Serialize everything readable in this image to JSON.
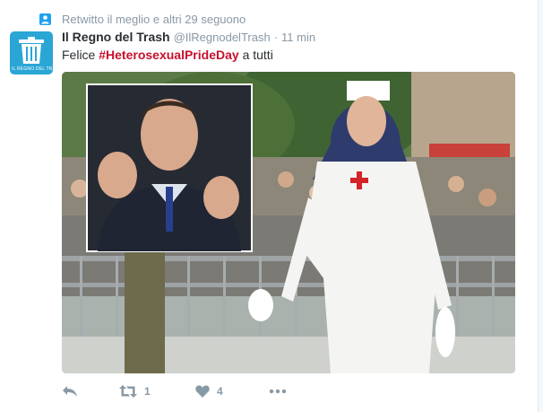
{
  "context": {
    "text": "Retwitto il meglio e altri 29 seguono",
    "icon": "user-icon"
  },
  "tweet": {
    "avatar_text": "IL REGNO DEL TRASH",
    "fullname": "Il Regno del Trash",
    "handle": "@IlRegnodelTrash",
    "separator": "·",
    "time": "11 min",
    "text_before": "Felice",
    "hashtag": "#HeterosexualPrideDay",
    "text_after": "a tutti"
  },
  "actions": {
    "reply_icon": "reply-icon",
    "retweet_icon": "retweet-icon",
    "retweet_count": "1",
    "like_icon": "heart-icon",
    "like_count": "4",
    "more_icon": "more-icon"
  },
  "colors": {
    "link": "#c8102e",
    "muted": "#8899a6",
    "avatar_bg": "#2aa6d5",
    "text": "#292f33"
  }
}
